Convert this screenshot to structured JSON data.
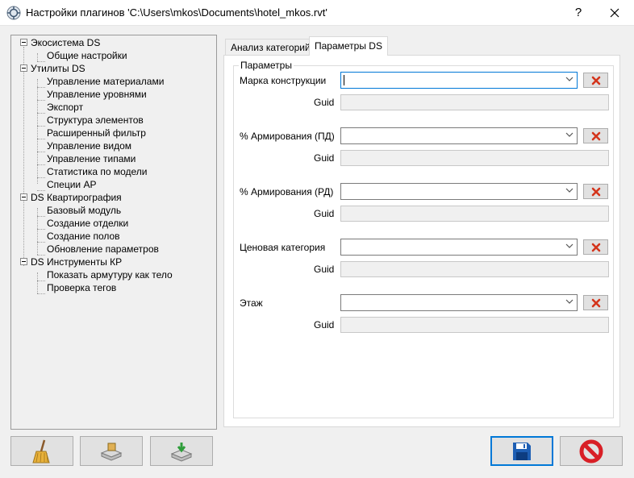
{
  "window": {
    "title": "Настройки плагинов 'C:\\Users\\mkos\\Documents\\hotel_mkos.rvt'",
    "help_glyph": "?",
    "icons": {
      "app": "plugin-settings-icon",
      "close": "close-icon"
    }
  },
  "tree": {
    "groups": [
      {
        "label": "Экосистема DS",
        "items": [
          "Общие настройки"
        ]
      },
      {
        "label": "Утилиты DS",
        "items": [
          "Управление материалами",
          "Управление уровнями",
          "Экспорт",
          "Структура элементов",
          "Расширенный фильтр",
          "Управление видом",
          "Управление типами",
          "Статистика по модели",
          "Специи АР"
        ]
      },
      {
        "label": "DS Квартирография",
        "items": [
          "Базовый модуль",
          "Создание отделки",
          "Создание полов",
          "Обновление параметров"
        ]
      },
      {
        "label": "DS Инструменты КР",
        "items": [
          "Показать армутуру как тело",
          "Проверка тегов"
        ]
      }
    ]
  },
  "tabs": [
    {
      "label": "Анализ категорий",
      "active": false
    },
    {
      "label": "Параметры DS",
      "active": true
    }
  ],
  "params_group": {
    "title": "Параметры",
    "guid_label": "Guid",
    "rows": [
      {
        "label": "Марка конструкции",
        "value": "",
        "guid": ""
      },
      {
        "label": "% Армирования (ПД)",
        "value": "",
        "guid": ""
      },
      {
        "label": "% Армирования (РД)",
        "value": "",
        "guid": ""
      },
      {
        "label": "Ценовая категория",
        "value": "",
        "guid": ""
      },
      {
        "label": "Этаж",
        "value": "",
        "guid": ""
      }
    ]
  },
  "bottom_buttons": {
    "left": [
      "broom-icon",
      "export-settings-icon",
      "import-settings-icon"
    ],
    "save": "save-icon",
    "cancel": "cancel-icon"
  },
  "colors": {
    "accent": "#0078d7",
    "clear_x": "#d4351c",
    "save_blue": "#1e5fb4",
    "cancel_red": "#d81f26"
  }
}
